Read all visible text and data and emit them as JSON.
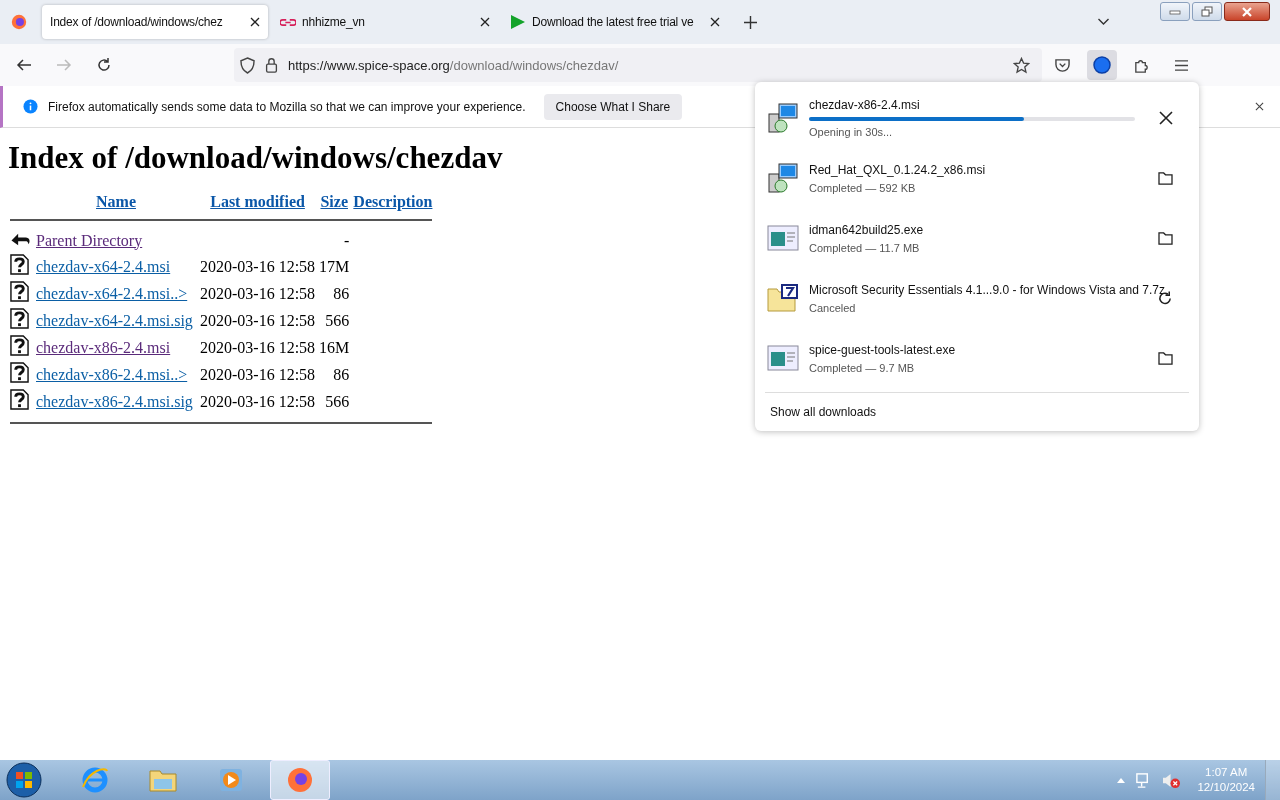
{
  "tabs": [
    {
      "title": "Index of /download/windows/chez",
      "selected": true
    },
    {
      "title": "nhhizme_vn",
      "selected": false
    },
    {
      "title": "Download the latest free trial ve",
      "selected": false
    }
  ],
  "address": {
    "host": "https://www.spice-space.org",
    "path": "/download/windows/chezdav/"
  },
  "notification": {
    "text": "Firefox automatically sends some data to Mozilla so that we can improve your experience.",
    "button": "Choose What I Share"
  },
  "page": {
    "heading": "Index of /download/windows/chezdav",
    "columns": [
      "Name",
      "Last modified",
      "Size",
      "Description"
    ],
    "rows": [
      {
        "kind": "parent",
        "name": "Parent Directory",
        "date": "",
        "size": "-",
        "visited": true
      },
      {
        "kind": "file",
        "name": "chezdav-x64-2.4.msi",
        "date": "2020-03-16 12:58",
        "size": "17M",
        "visited": false
      },
      {
        "kind": "file",
        "name": "chezdav-x64-2.4.msi..>",
        "date": "2020-03-16 12:58",
        "size": "86",
        "visited": false
      },
      {
        "kind": "file",
        "name": "chezdav-x64-2.4.msi.sig",
        "date": "2020-03-16 12:58",
        "size": "566",
        "visited": false
      },
      {
        "kind": "file",
        "name": "chezdav-x86-2.4.msi",
        "date": "2020-03-16 12:58",
        "size": "16M",
        "visited": true
      },
      {
        "kind": "file",
        "name": "chezdav-x86-2.4.msi..>",
        "date": "2020-03-16 12:58",
        "size": "86",
        "visited": false
      },
      {
        "kind": "file",
        "name": "chezdav-x86-2.4.msi.sig",
        "date": "2020-03-16 12:58",
        "size": "566",
        "visited": false
      }
    ]
  },
  "downloads": {
    "items": [
      {
        "kind": "active",
        "name": "chezdav-x86-2.4.msi",
        "status": "Opening in 30s...",
        "level": 0.66
      },
      {
        "kind": "done",
        "name": "Red_Hat_QXL_0.1.24.2_x86.msi",
        "status": "Completed — 592 KB"
      },
      {
        "kind": "done",
        "name": "idman642build25.exe",
        "status": "Completed — 11.7 MB"
      },
      {
        "kind": "canceled",
        "name": "Microsoft Security Essentials 4.1...9.0 - for Windows Vista and 7.7z",
        "status": "Canceled"
      },
      {
        "kind": "done",
        "name": "spice-guest-tools-latest.exe",
        "status": "Completed — 9.7 MB"
      }
    ],
    "show_all": "Show all downloads"
  },
  "taskbar": {
    "apps": [
      {
        "kind": "ie",
        "selected": false
      },
      {
        "kind": "explorer",
        "selected": false
      },
      {
        "kind": "media",
        "selected": false
      },
      {
        "kind": "firefox",
        "selected": true
      }
    ],
    "time": "1:07 AM",
    "date": "12/10/2024"
  }
}
